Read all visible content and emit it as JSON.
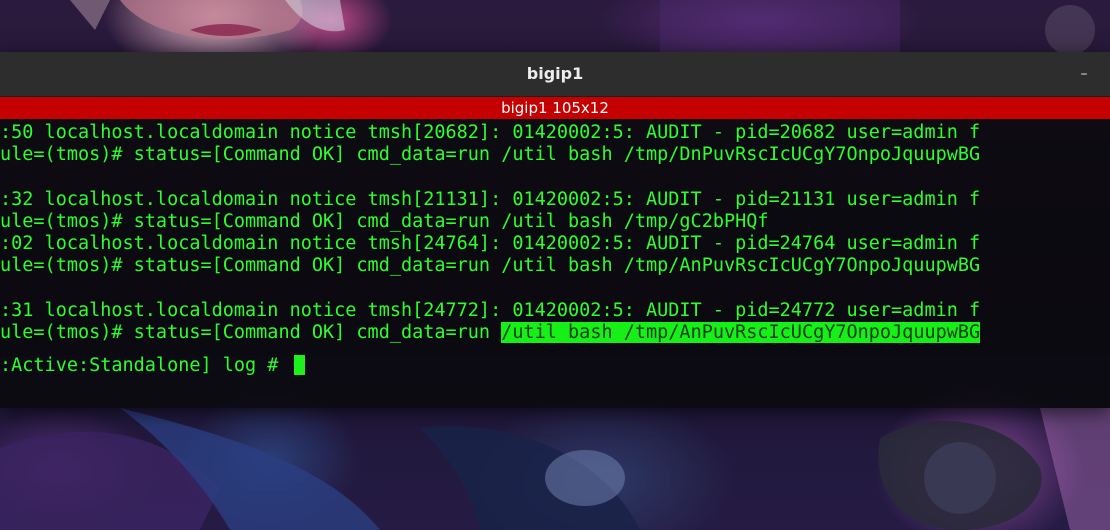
{
  "window": {
    "title": "bigip1",
    "minimize_glyph": "–"
  },
  "tab": {
    "label": "bigip1 105x12"
  },
  "terminal": {
    "lines": [
      ":50 localhost.localdomain notice tmsh[20682]: 01420002:5: AUDIT - pid=20682 user=admin f",
      "ule=(tmos)# status=[Command OK] cmd_data=run /util bash /tmp/DnPuvRscIcUCgY7OnpoJquupwBG",
      "",
      ":32 localhost.localdomain notice tmsh[21131]: 01420002:5: AUDIT - pid=21131 user=admin f",
      "ule=(tmos)# status=[Command OK] cmd_data=run /util bash /tmp/gC2bPHQf",
      ":02 localhost.localdomain notice tmsh[24764]: 01420002:5: AUDIT - pid=24764 user=admin f",
      "ule=(tmos)# status=[Command OK] cmd_data=run /util bash /tmp/AnPuvRscIcUCgY7OnpoJquupwBG",
      "",
      ":31 localhost.localdomain notice tmsh[24772]: 01420002:5: AUDIT - pid=24772 user=admin f"
    ],
    "highlight_line": {
      "prefix": "ule=(tmos)# status=[Command OK] cmd_data=run ",
      "highlighted": "/util bash /tmp/AnPuvRscIcUCgY7OnpoJquupwBG"
    },
    "prompt": ":Active:Standalone] log # "
  },
  "colors": {
    "terminal_text": "#2cff2c",
    "tab_bar": "#c40000",
    "titlebar": "#2d2d2d",
    "highlight_bg": "#16f016"
  }
}
